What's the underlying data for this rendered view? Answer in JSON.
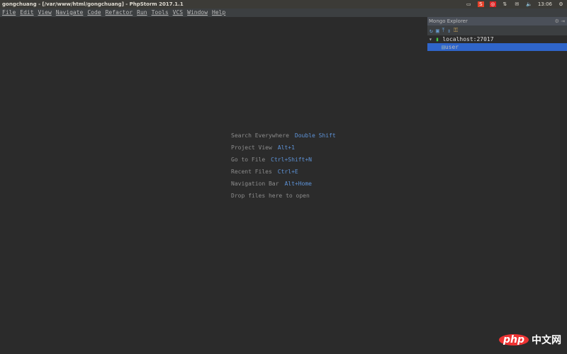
{
  "window": {
    "title": "gongchuang - [/var/www/html/gongchuang] - PhpStorm 2017.1.1"
  },
  "tray": {
    "time": "13:06",
    "icons": [
      "keyboard-icon",
      "sogou-icon",
      "netease-music-icon",
      "network-icon",
      "mail-icon",
      "volume-icon",
      "power-gear-icon"
    ]
  },
  "menu": [
    "File",
    "Edit",
    "View",
    "Navigate",
    "Code",
    "Refactor",
    "Run",
    "Tools",
    "VCS",
    "Window",
    "Help"
  ],
  "hints": [
    {
      "label": "Search Everywhere",
      "shortcut": "Double Shift"
    },
    {
      "label": "Project View",
      "shortcut": "Alt+1"
    },
    {
      "label": "Go to File",
      "shortcut": "Ctrl+Shift+N"
    },
    {
      "label": "Recent Files",
      "shortcut": "Ctrl+E"
    },
    {
      "label": "Navigation Bar",
      "shortcut": "Alt+Home"
    }
  ],
  "drop_hint": "Drop files here to open",
  "panel": {
    "title": "Mongo Explorer",
    "server": "localhost:27017",
    "database": "user"
  },
  "watermark": {
    "logo": "php",
    "text": "中文网"
  }
}
